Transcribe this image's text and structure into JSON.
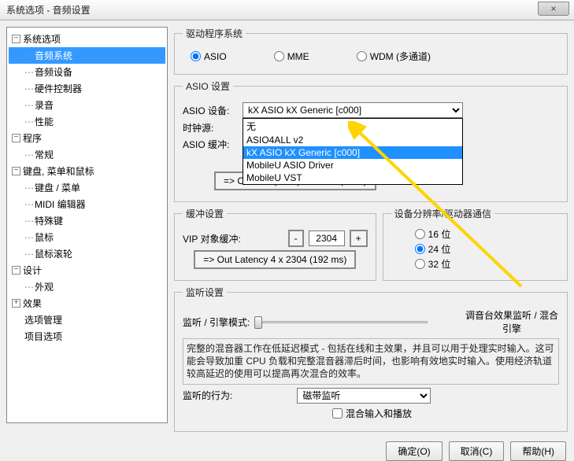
{
  "window": {
    "title": "系统选项 - 音频设置",
    "close": "×"
  },
  "tree": {
    "n0": "系统选项",
    "n0_0": "音频系统",
    "n0_1": "音频设备",
    "n0_2": "硬件控制器",
    "n0_3": "录音",
    "n0_4": "性能",
    "n1": "程序",
    "n1_0": "常规",
    "n2": "键盘, 菜单和鼠标",
    "n2_0": "键盘 / 菜单",
    "n2_1": "MIDI 编辑器",
    "n2_2": "特殊键",
    "n2_3": "鼠标",
    "n2_4": "鼠标滚轮",
    "n3": "设计",
    "n3_0": "外观",
    "n4": "效果",
    "n5": "选项管理",
    "n6": "项目选项"
  },
  "driver": {
    "legend": "驱动程序系统",
    "asio": "ASIO",
    "mme": "MME",
    "wdm": "WDM (多通道)"
  },
  "asio": {
    "legend": "ASIO 设置",
    "device_label": "ASIO 设备:",
    "device_value": "kX ASIO kX Generic [c000]",
    "clock_label": "时钟源:",
    "buffer_label": "ASIO 缓冲:",
    "summary": "=> Out 384 (8 ms) + In 384 (8 ms)",
    "options": {
      "o0": "无",
      "o1": "ASIO4ALL v2",
      "o2": "kX ASIO kX Generic [c000]",
      "o3": "MobileU ASIO Driver",
      "o4": "MobileU VST"
    }
  },
  "buffer": {
    "legend": "缓冲设置",
    "vip_label": "VIP 对象缓冲:",
    "minus": "-",
    "value": "2304",
    "plus": "+",
    "summary": "=> Out Latency 4 x 2304 (192 ms)"
  },
  "bitrate": {
    "legend": "设备分辨率/驱动器通信",
    "b16": "16 位",
    "b24": "24 位",
    "b32": "32 位"
  },
  "monitor": {
    "legend": "监听设置",
    "mode_label": "监听 / 引擎模式:",
    "side_label": "调音台效果监听 / 混合引擎",
    "desc": "完整的混音器工作在低延迟模式 - 包括在线和主效果，并且可以用于处理实时输入。这可能会导致加重 CPU 负载和完整混音器滞后时间，也影响有效地实时输入。使用经济轨道较高延迟的使用可以提高再次混合的效率。",
    "behavior_label": "监听的行为:",
    "behavior_value": "磁带监听",
    "mix_checkbox": "混合输入和播放"
  },
  "buttons": {
    "ok": "确定(O)",
    "cancel": "取消(C)",
    "help": "帮助(H)"
  }
}
